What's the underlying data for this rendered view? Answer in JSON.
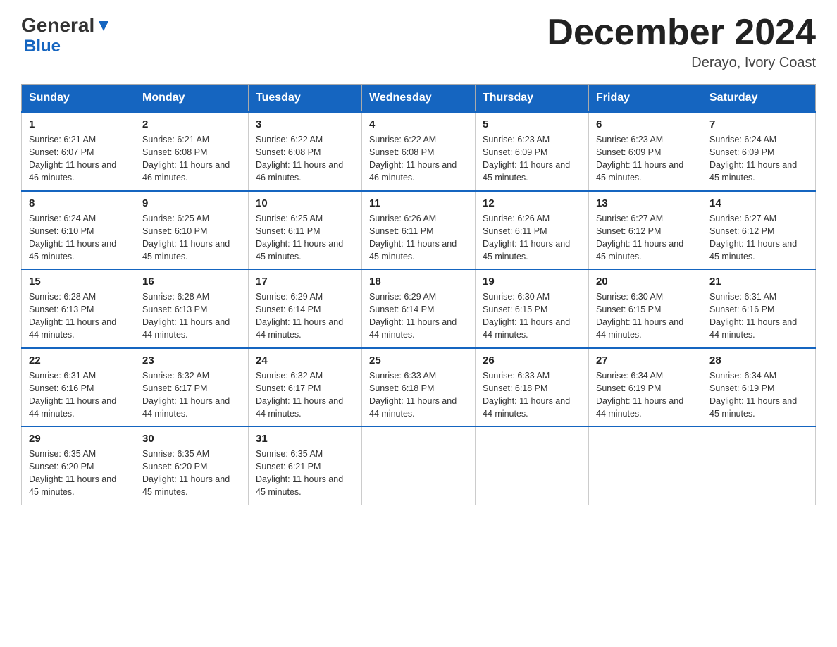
{
  "header": {
    "logo_general": "General",
    "logo_blue": "Blue",
    "month_title": "December 2024",
    "location": "Derayo, Ivory Coast"
  },
  "weekdays": [
    "Sunday",
    "Monday",
    "Tuesday",
    "Wednesday",
    "Thursday",
    "Friday",
    "Saturday"
  ],
  "weeks": [
    [
      {
        "day": "1",
        "sunrise": "Sunrise: 6:21 AM",
        "sunset": "Sunset: 6:07 PM",
        "daylight": "Daylight: 11 hours and 46 minutes."
      },
      {
        "day": "2",
        "sunrise": "Sunrise: 6:21 AM",
        "sunset": "Sunset: 6:08 PM",
        "daylight": "Daylight: 11 hours and 46 minutes."
      },
      {
        "day": "3",
        "sunrise": "Sunrise: 6:22 AM",
        "sunset": "Sunset: 6:08 PM",
        "daylight": "Daylight: 11 hours and 46 minutes."
      },
      {
        "day": "4",
        "sunrise": "Sunrise: 6:22 AM",
        "sunset": "Sunset: 6:08 PM",
        "daylight": "Daylight: 11 hours and 46 minutes."
      },
      {
        "day": "5",
        "sunrise": "Sunrise: 6:23 AM",
        "sunset": "Sunset: 6:09 PM",
        "daylight": "Daylight: 11 hours and 45 minutes."
      },
      {
        "day": "6",
        "sunrise": "Sunrise: 6:23 AM",
        "sunset": "Sunset: 6:09 PM",
        "daylight": "Daylight: 11 hours and 45 minutes."
      },
      {
        "day": "7",
        "sunrise": "Sunrise: 6:24 AM",
        "sunset": "Sunset: 6:09 PM",
        "daylight": "Daylight: 11 hours and 45 minutes."
      }
    ],
    [
      {
        "day": "8",
        "sunrise": "Sunrise: 6:24 AM",
        "sunset": "Sunset: 6:10 PM",
        "daylight": "Daylight: 11 hours and 45 minutes."
      },
      {
        "day": "9",
        "sunrise": "Sunrise: 6:25 AM",
        "sunset": "Sunset: 6:10 PM",
        "daylight": "Daylight: 11 hours and 45 minutes."
      },
      {
        "day": "10",
        "sunrise": "Sunrise: 6:25 AM",
        "sunset": "Sunset: 6:11 PM",
        "daylight": "Daylight: 11 hours and 45 minutes."
      },
      {
        "day": "11",
        "sunrise": "Sunrise: 6:26 AM",
        "sunset": "Sunset: 6:11 PM",
        "daylight": "Daylight: 11 hours and 45 minutes."
      },
      {
        "day": "12",
        "sunrise": "Sunrise: 6:26 AM",
        "sunset": "Sunset: 6:11 PM",
        "daylight": "Daylight: 11 hours and 45 minutes."
      },
      {
        "day": "13",
        "sunrise": "Sunrise: 6:27 AM",
        "sunset": "Sunset: 6:12 PM",
        "daylight": "Daylight: 11 hours and 45 minutes."
      },
      {
        "day": "14",
        "sunrise": "Sunrise: 6:27 AM",
        "sunset": "Sunset: 6:12 PM",
        "daylight": "Daylight: 11 hours and 45 minutes."
      }
    ],
    [
      {
        "day": "15",
        "sunrise": "Sunrise: 6:28 AM",
        "sunset": "Sunset: 6:13 PM",
        "daylight": "Daylight: 11 hours and 44 minutes."
      },
      {
        "day": "16",
        "sunrise": "Sunrise: 6:28 AM",
        "sunset": "Sunset: 6:13 PM",
        "daylight": "Daylight: 11 hours and 44 minutes."
      },
      {
        "day": "17",
        "sunrise": "Sunrise: 6:29 AM",
        "sunset": "Sunset: 6:14 PM",
        "daylight": "Daylight: 11 hours and 44 minutes."
      },
      {
        "day": "18",
        "sunrise": "Sunrise: 6:29 AM",
        "sunset": "Sunset: 6:14 PM",
        "daylight": "Daylight: 11 hours and 44 minutes."
      },
      {
        "day": "19",
        "sunrise": "Sunrise: 6:30 AM",
        "sunset": "Sunset: 6:15 PM",
        "daylight": "Daylight: 11 hours and 44 minutes."
      },
      {
        "day": "20",
        "sunrise": "Sunrise: 6:30 AM",
        "sunset": "Sunset: 6:15 PM",
        "daylight": "Daylight: 11 hours and 44 minutes."
      },
      {
        "day": "21",
        "sunrise": "Sunrise: 6:31 AM",
        "sunset": "Sunset: 6:16 PM",
        "daylight": "Daylight: 11 hours and 44 minutes."
      }
    ],
    [
      {
        "day": "22",
        "sunrise": "Sunrise: 6:31 AM",
        "sunset": "Sunset: 6:16 PM",
        "daylight": "Daylight: 11 hours and 44 minutes."
      },
      {
        "day": "23",
        "sunrise": "Sunrise: 6:32 AM",
        "sunset": "Sunset: 6:17 PM",
        "daylight": "Daylight: 11 hours and 44 minutes."
      },
      {
        "day": "24",
        "sunrise": "Sunrise: 6:32 AM",
        "sunset": "Sunset: 6:17 PM",
        "daylight": "Daylight: 11 hours and 44 minutes."
      },
      {
        "day": "25",
        "sunrise": "Sunrise: 6:33 AM",
        "sunset": "Sunset: 6:18 PM",
        "daylight": "Daylight: 11 hours and 44 minutes."
      },
      {
        "day": "26",
        "sunrise": "Sunrise: 6:33 AM",
        "sunset": "Sunset: 6:18 PM",
        "daylight": "Daylight: 11 hours and 44 minutes."
      },
      {
        "day": "27",
        "sunrise": "Sunrise: 6:34 AM",
        "sunset": "Sunset: 6:19 PM",
        "daylight": "Daylight: 11 hours and 44 minutes."
      },
      {
        "day": "28",
        "sunrise": "Sunrise: 6:34 AM",
        "sunset": "Sunset: 6:19 PM",
        "daylight": "Daylight: 11 hours and 45 minutes."
      }
    ],
    [
      {
        "day": "29",
        "sunrise": "Sunrise: 6:35 AM",
        "sunset": "Sunset: 6:20 PM",
        "daylight": "Daylight: 11 hours and 45 minutes."
      },
      {
        "day": "30",
        "sunrise": "Sunrise: 6:35 AM",
        "sunset": "Sunset: 6:20 PM",
        "daylight": "Daylight: 11 hours and 45 minutes."
      },
      {
        "day": "31",
        "sunrise": "Sunrise: 6:35 AM",
        "sunset": "Sunset: 6:21 PM",
        "daylight": "Daylight: 11 hours and 45 minutes."
      },
      null,
      null,
      null,
      null
    ]
  ]
}
